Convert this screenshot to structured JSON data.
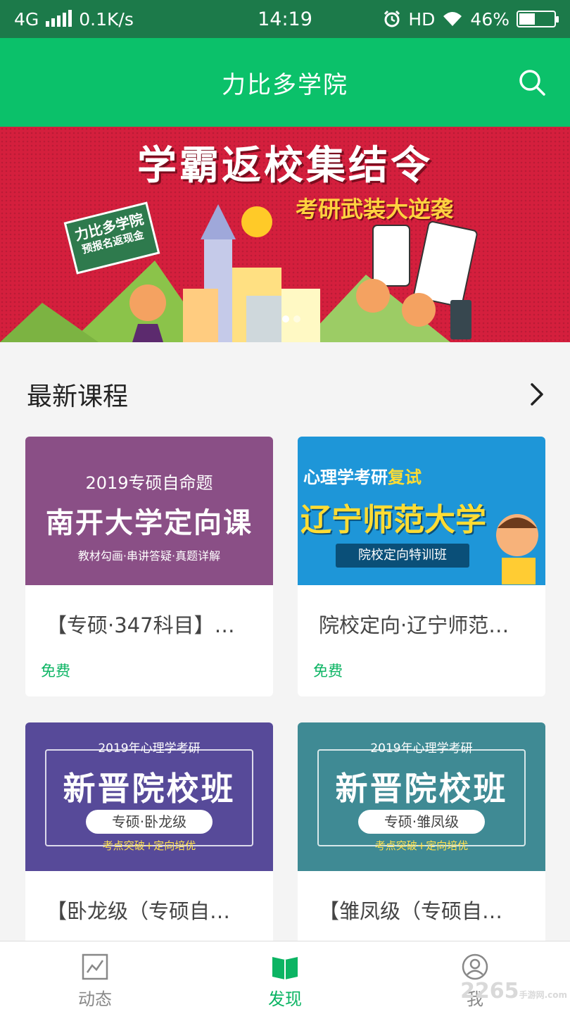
{
  "status_bar": {
    "network": "4G",
    "speed": "0.1K/s",
    "time": "14:19",
    "hd": "HD",
    "battery": "46%",
    "battery_level": 0.46
  },
  "app_bar": {
    "title": "力比多学院",
    "search_icon": "search-icon"
  },
  "banner": {
    "headline": "学霸返校集结令",
    "subline": "考研武装大逆袭",
    "sign_title": "力比多学院",
    "sign_sub": "预报名返现金",
    "page_count": 2,
    "active_page": 1
  },
  "section": {
    "title": "最新课程",
    "more_icon": "chevron-right-icon"
  },
  "courses": [
    {
      "thumb_line1": "2019专硕自命题",
      "thumb_line2": "南开大学定向课",
      "thumb_line3": "教材勾画·串讲答疑·真题详解",
      "name": "【专硕·347科目】…",
      "price": "免费"
    },
    {
      "thumb_line1_a": "心理学考研",
      "thumb_line1_b": "复试",
      "thumb_line2": "辽宁师范大学",
      "thumb_line3": "院校定向特训班",
      "name": "院校定向·辽宁师范…",
      "price": "免费"
    },
    {
      "thumb_line1": "2019年心理学考研",
      "thumb_line2": "新晋院校班",
      "thumb_line3": "专硕·卧龙级",
      "thumb_line4": "考点突破+定向培优",
      "name": "【卧龙级（专硕自…"
    },
    {
      "thumb_line1": "2019年心理学考研",
      "thumb_line2": "新晋院校班",
      "thumb_line3": "专硕·雏凤级",
      "thumb_line4": "考点突破+定向培优",
      "name": "【雏凤级（专硕自…"
    }
  ],
  "tabs": [
    {
      "label": "动态",
      "icon": "chart-icon",
      "active": false
    },
    {
      "label": "发现",
      "icon": "book-icon",
      "active": true
    },
    {
      "label": "我",
      "icon": "user-icon",
      "active": false
    }
  ],
  "watermark": {
    "text": "2265",
    "sub": "手游网",
    "domain": ".com"
  },
  "colors": {
    "status_bar": "#1c7a4a",
    "app_bar": "#0bc16a",
    "accent": "#0bb463",
    "banner": "#d41f3d"
  }
}
